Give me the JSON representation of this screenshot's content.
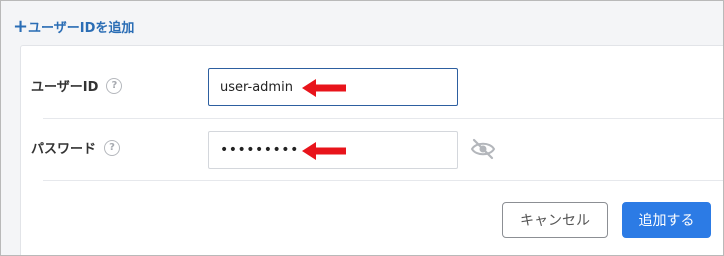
{
  "add_link": {
    "icon": "plus-icon",
    "label": "ユーザーIDを追加"
  },
  "form": {
    "user_id": {
      "label": "ユーザーID",
      "help_icon": "help-circle-icon",
      "help_glyph": "?",
      "value": "user-admin"
    },
    "password": {
      "label": "パスワード",
      "help_icon": "help-circle-icon",
      "help_glyph": "?",
      "value": "•••••••••",
      "toggle_icon": "eye-slash-icon"
    }
  },
  "buttons": {
    "cancel_label": "キャンセル",
    "add_label": "追加する"
  },
  "colors": {
    "accent": "#2c7be5",
    "link": "#2a6db5",
    "annotation_arrow": "#e8141b"
  }
}
